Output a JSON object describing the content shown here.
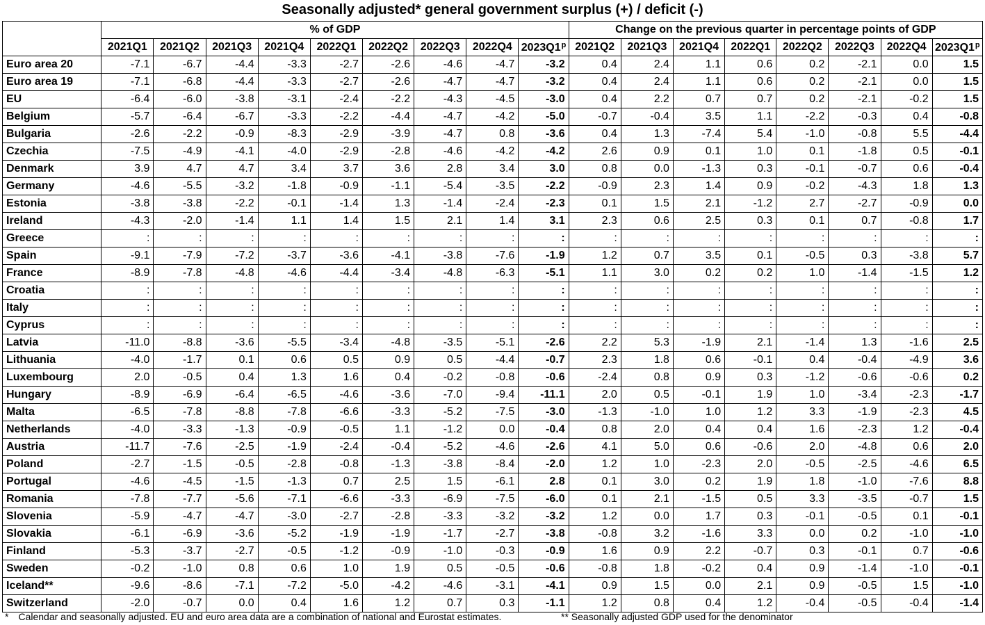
{
  "title": "Seasonally adjusted* general government surplus (+) / deficit (-)",
  "group_headers": {
    "pct_gdp": "% of GDP",
    "change": "Change on the previous quarter in percentage points of GDP"
  },
  "quarters_pct": [
    "2021Q1",
    "2021Q2",
    "2021Q3",
    "2021Q4",
    "2022Q1",
    "2022Q2",
    "2022Q3",
    "2022Q4",
    "2023Q1"
  ],
  "quarters_change": [
    "2021Q2",
    "2021Q3",
    "2021Q4",
    "2022Q1",
    "2022Q2",
    "2022Q3",
    "2022Q4",
    "2023Q1"
  ],
  "provisional_mark": "p",
  "rows": [
    {
      "name": "Euro area 20",
      "pct": [
        "-7.1",
        "-6.7",
        "-4.4",
        "-3.3",
        "-2.7",
        "-2.6",
        "-4.6",
        "-4.7",
        "-3.2"
      ],
      "chg": [
        "0.4",
        "2.4",
        "1.1",
        "0.6",
        "0.2",
        "-2.1",
        "0.0",
        "1.5"
      ]
    },
    {
      "name": "Euro area 19",
      "pct": [
        "-7.1",
        "-6.8",
        "-4.4",
        "-3.3",
        "-2.7",
        "-2.6",
        "-4.7",
        "-4.7",
        "-3.2"
      ],
      "chg": [
        "0.4",
        "2.4",
        "1.1",
        "0.6",
        "0.2",
        "-2.1",
        "0.0",
        "1.5"
      ]
    },
    {
      "name": "EU",
      "pct": [
        "-6.4",
        "-6.0",
        "-3.8",
        "-3.1",
        "-2.4",
        "-2.2",
        "-4.3",
        "-4.5",
        "-3.0"
      ],
      "chg": [
        "0.4",
        "2.2",
        "0.7",
        "0.7",
        "0.2",
        "-2.1",
        "-0.2",
        "1.5"
      ]
    },
    {
      "name": "Belgium",
      "pct": [
        "-5.7",
        "-6.4",
        "-6.7",
        "-3.3",
        "-2.2",
        "-4.4",
        "-4.7",
        "-4.2",
        "-5.0"
      ],
      "chg": [
        "-0.7",
        "-0.4",
        "3.5",
        "1.1",
        "-2.2",
        "-0.3",
        "0.4",
        "-0.8"
      ]
    },
    {
      "name": "Bulgaria",
      "pct": [
        "-2.6",
        "-2.2",
        "-0.9",
        "-8.3",
        "-2.9",
        "-3.9",
        "-4.7",
        "0.8",
        "-3.6"
      ],
      "chg": [
        "0.4",
        "1.3",
        "-7.4",
        "5.4",
        "-1.0",
        "-0.8",
        "5.5",
        "-4.4"
      ]
    },
    {
      "name": "Czechia",
      "pct": [
        "-7.5",
        "-4.9",
        "-4.1",
        "-4.0",
        "-2.9",
        "-2.8",
        "-4.6",
        "-4.2",
        "-4.2"
      ],
      "chg": [
        "2.6",
        "0.9",
        "0.1",
        "1.0",
        "0.1",
        "-1.8",
        "0.5",
        "-0.1"
      ]
    },
    {
      "name": "Denmark",
      "pct": [
        "3.9",
        "4.7",
        "4.7",
        "3.4",
        "3.7",
        "3.6",
        "2.8",
        "3.4",
        "3.0"
      ],
      "chg": [
        "0.8",
        "0.0",
        "-1.3",
        "0.3",
        "-0.1",
        "-0.7",
        "0.6",
        "-0.4"
      ]
    },
    {
      "name": "Germany",
      "pct": [
        "-4.6",
        "-5.5",
        "-3.2",
        "-1.8",
        "-0.9",
        "-1.1",
        "-5.4",
        "-3.5",
        "-2.2"
      ],
      "chg": [
        "-0.9",
        "2.3",
        "1.4",
        "0.9",
        "-0.2",
        "-4.3",
        "1.8",
        "1.3"
      ]
    },
    {
      "name": "Estonia",
      "pct": [
        "-3.8",
        "-3.8",
        "-2.2",
        "-0.1",
        "-1.4",
        "1.3",
        "-1.4",
        "-2.4",
        "-2.3"
      ],
      "chg": [
        "0.1",
        "1.5",
        "2.1",
        "-1.2",
        "2.7",
        "-2.7",
        "-0.9",
        "0.0"
      ]
    },
    {
      "name": "Ireland",
      "pct": [
        "-4.3",
        "-2.0",
        "-1.4",
        "1.1",
        "1.4",
        "1.5",
        "2.1",
        "1.4",
        "3.1"
      ],
      "chg": [
        "2.3",
        "0.6",
        "2.5",
        "0.3",
        "0.1",
        "0.7",
        "-0.8",
        "1.7"
      ]
    },
    {
      "name": "Greece",
      "pct": [
        ":",
        ":",
        ":",
        ":",
        ":",
        ":",
        ":",
        ":",
        ":"
      ],
      "chg": [
        ":",
        ":",
        ":",
        ":",
        ":",
        ":",
        ":",
        ":"
      ]
    },
    {
      "name": "Spain",
      "pct": [
        "-9.1",
        "-7.9",
        "-7.2",
        "-3.7",
        "-3.6",
        "-4.1",
        "-3.8",
        "-7.6",
        "-1.9"
      ],
      "chg": [
        "1.2",
        "0.7",
        "3.5",
        "0.1",
        "-0.5",
        "0.3",
        "-3.8",
        "5.7"
      ]
    },
    {
      "name": "France",
      "pct": [
        "-8.9",
        "-7.8",
        "-4.8",
        "-4.6",
        "-4.4",
        "-3.4",
        "-4.8",
        "-6.3",
        "-5.1"
      ],
      "chg": [
        "1.1",
        "3.0",
        "0.2",
        "0.2",
        "1.0",
        "-1.4",
        "-1.5",
        "1.2"
      ]
    },
    {
      "name": "Croatia",
      "pct": [
        ":",
        ":",
        ":",
        ":",
        ":",
        ":",
        ":",
        ":",
        ":"
      ],
      "chg": [
        ":",
        ":",
        ":",
        ":",
        ":",
        ":",
        ":",
        ":"
      ]
    },
    {
      "name": "Italy",
      "pct": [
        ":",
        ":",
        ":",
        ":",
        ":",
        ":",
        ":",
        ":",
        ":"
      ],
      "chg": [
        ":",
        ":",
        ":",
        ":",
        ":",
        ":",
        ":",
        ":"
      ]
    },
    {
      "name": "Cyprus",
      "pct": [
        ":",
        ":",
        ":",
        ":",
        ":",
        ":",
        ":",
        ":",
        ":"
      ],
      "chg": [
        ":",
        ":",
        ":",
        ":",
        ":",
        ":",
        ":",
        ":"
      ]
    },
    {
      "name": "Latvia",
      "pct": [
        "-11.0",
        "-8.8",
        "-3.6",
        "-5.5",
        "-3.4",
        "-4.8",
        "-3.5",
        "-5.1",
        "-2.6"
      ],
      "chg": [
        "2.2",
        "5.3",
        "-1.9",
        "2.1",
        "-1.4",
        "1.3",
        "-1.6",
        "2.5"
      ]
    },
    {
      "name": "Lithuania",
      "pct": [
        "-4.0",
        "-1.7",
        "0.1",
        "0.6",
        "0.5",
        "0.9",
        "0.5",
        "-4.4",
        "-0.7"
      ],
      "chg": [
        "2.3",
        "1.8",
        "0.6",
        "-0.1",
        "0.4",
        "-0.4",
        "-4.9",
        "3.6"
      ]
    },
    {
      "name": "Luxembourg",
      "pct": [
        "2.0",
        "-0.5",
        "0.4",
        "1.3",
        "1.6",
        "0.4",
        "-0.2",
        "-0.8",
        "-0.6"
      ],
      "chg": [
        "-2.4",
        "0.8",
        "0.9",
        "0.3",
        "-1.2",
        "-0.6",
        "-0.6",
        "0.2"
      ]
    },
    {
      "name": "Hungary",
      "pct": [
        "-8.9",
        "-6.9",
        "-6.4",
        "-6.5",
        "-4.6",
        "-3.6",
        "-7.0",
        "-9.4",
        "-11.1"
      ],
      "chg": [
        "2.0",
        "0.5",
        "-0.1",
        "1.9",
        "1.0",
        "-3.4",
        "-2.3",
        "-1.7"
      ]
    },
    {
      "name": "Malta",
      "pct": [
        "-6.5",
        "-7.8",
        "-8.8",
        "-7.8",
        "-6.6",
        "-3.3",
        "-5.2",
        "-7.5",
        "-3.0"
      ],
      "chg": [
        "-1.3",
        "-1.0",
        "1.0",
        "1.2",
        "3.3",
        "-1.9",
        "-2.3",
        "4.5"
      ]
    },
    {
      "name": "Netherlands",
      "pct": [
        "-4.0",
        "-3.3",
        "-1.3",
        "-0.9",
        "-0.5",
        "1.1",
        "-1.2",
        "0.0",
        "-0.4"
      ],
      "chg": [
        "0.8",
        "2.0",
        "0.4",
        "0.4",
        "1.6",
        "-2.3",
        "1.2",
        "-0.4"
      ]
    },
    {
      "name": "Austria",
      "pct": [
        "-11.7",
        "-7.6",
        "-2.5",
        "-1.9",
        "-2.4",
        "-0.4",
        "-5.2",
        "-4.6",
        "-2.6"
      ],
      "chg": [
        "4.1",
        "5.0",
        "0.6",
        "-0.6",
        "2.0",
        "-4.8",
        "0.6",
        "2.0"
      ]
    },
    {
      "name": "Poland",
      "pct": [
        "-2.7",
        "-1.5",
        "-0.5",
        "-2.8",
        "-0.8",
        "-1.3",
        "-3.8",
        "-8.4",
        "-2.0"
      ],
      "chg": [
        "1.2",
        "1.0",
        "-2.3",
        "2.0",
        "-0.5",
        "-2.5",
        "-4.6",
        "6.5"
      ]
    },
    {
      "name": "Portugal",
      "pct": [
        "-4.6",
        "-4.5",
        "-1.5",
        "-1.3",
        "0.7",
        "2.5",
        "1.5",
        "-6.1",
        "2.8"
      ],
      "chg": [
        "0.1",
        "3.0",
        "0.2",
        "1.9",
        "1.8",
        "-1.0",
        "-7.6",
        "8.8"
      ]
    },
    {
      "name": "Romania",
      "pct": [
        "-7.8",
        "-7.7",
        "-5.6",
        "-7.1",
        "-6.6",
        "-3.3",
        "-6.9",
        "-7.5",
        "-6.0"
      ],
      "chg": [
        "0.1",
        "2.1",
        "-1.5",
        "0.5",
        "3.3",
        "-3.5",
        "-0.7",
        "1.5"
      ]
    },
    {
      "name": "Slovenia",
      "pct": [
        "-5.9",
        "-4.7",
        "-4.7",
        "-3.0",
        "-2.7",
        "-2.8",
        "-3.3",
        "-3.2",
        "-3.2"
      ],
      "chg": [
        "1.2",
        "0.0",
        "1.7",
        "0.3",
        "-0.1",
        "-0.5",
        "0.1",
        "-0.1"
      ]
    },
    {
      "name": "Slovakia",
      "pct": [
        "-6.1",
        "-6.9",
        "-3.6",
        "-5.2",
        "-1.9",
        "-1.9",
        "-1.7",
        "-2.7",
        "-3.8"
      ],
      "chg": [
        "-0.8",
        "3.2",
        "-1.6",
        "3.3",
        "0.0",
        "0.2",
        "-1.0",
        "-1.0"
      ]
    },
    {
      "name": "Finland",
      "pct": [
        "-5.3",
        "-3.7",
        "-2.7",
        "-0.5",
        "-1.2",
        "-0.9",
        "-1.0",
        "-0.3",
        "-0.9"
      ],
      "chg": [
        "1.6",
        "0.9",
        "2.2",
        "-0.7",
        "0.3",
        "-0.1",
        "0.7",
        "-0.6"
      ]
    },
    {
      "name": "Sweden",
      "pct": [
        "-0.2",
        "-1.0",
        "0.8",
        "0.6",
        "1.0",
        "1.9",
        "0.5",
        "-0.5",
        "-0.6"
      ],
      "chg": [
        "-0.8",
        "1.8",
        "-0.2",
        "0.4",
        "0.9",
        "-1.4",
        "-1.0",
        "-0.1"
      ]
    },
    {
      "name": "Iceland**",
      "pct": [
        "-9.6",
        "-8.6",
        "-7.1",
        "-7.2",
        "-5.0",
        "-4.2",
        "-4.6",
        "-3.1",
        "-4.1"
      ],
      "chg": [
        "0.9",
        "1.5",
        "0.0",
        "2.1",
        "0.9",
        "-0.5",
        "1.5",
        "-1.0"
      ]
    },
    {
      "name": "Switzerland",
      "pct": [
        "-2.0",
        "-0.7",
        "0.0",
        "0.4",
        "1.6",
        "1.2",
        "0.7",
        "0.3",
        "-1.1"
      ],
      "chg": [
        "1.2",
        "0.8",
        "0.4",
        "1.2",
        "-0.4",
        "-0.5",
        "-0.4",
        "-1.4"
      ]
    }
  ],
  "footnotes": {
    "note1_mark": "*",
    "note1_text": "Calendar and seasonally adjusted. EU and euro area data are a combination of national and Eurostat estimates.",
    "note2_text": "** Seasonally adjusted GDP used for the denominator"
  }
}
